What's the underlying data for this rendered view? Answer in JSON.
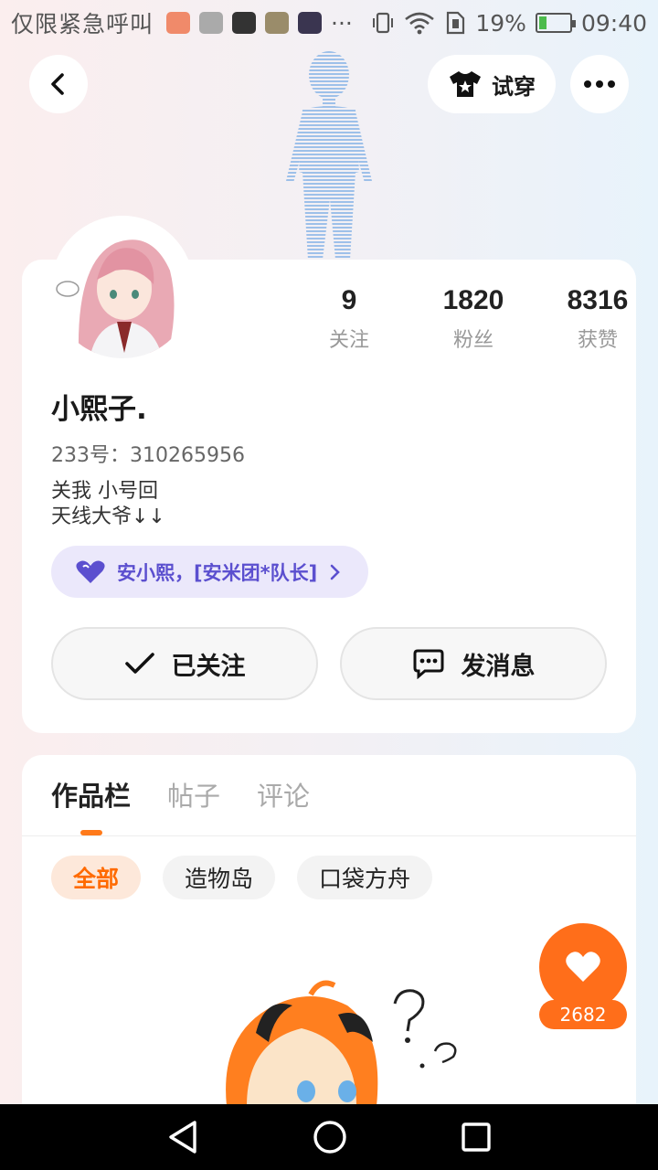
{
  "status_bar": {
    "carrier": "仅限紧急呼叫",
    "more": "···",
    "battery": "19%",
    "battery_level": 0.19,
    "time": "09:40"
  },
  "header": {
    "back_icon": "chevron-left-icon",
    "try_on_label": "试穿",
    "more_icon": "more-dots-icon"
  },
  "profile": {
    "stats": [
      {
        "value": "9",
        "label": "关注"
      },
      {
        "value": "1820",
        "label": "粉丝"
      },
      {
        "value": "8316",
        "label": "获赞"
      }
    ],
    "nickname": "小熙子.",
    "uid": "233号：310265956",
    "bio": "关我 小号回\n天线大爷↓↓",
    "badge_text": "安小熙，[安米团*队长]",
    "follow_button": "已关注",
    "message_button": "发消息"
  },
  "works": {
    "tabs": [
      {
        "label": "作品栏",
        "active": true
      },
      {
        "label": "帖子",
        "active": false
      },
      {
        "label": "评论",
        "active": false
      }
    ],
    "chips": [
      {
        "label": "全部",
        "active": true
      },
      {
        "label": "造物岛",
        "active": false
      },
      {
        "label": "口袋方舟",
        "active": false
      }
    ]
  },
  "like_fab": {
    "count": "2682"
  },
  "colors": {
    "accent": "#ff6e1a",
    "badge_text": "#5b4fcf",
    "badge_bg": "#ebe8fb"
  }
}
